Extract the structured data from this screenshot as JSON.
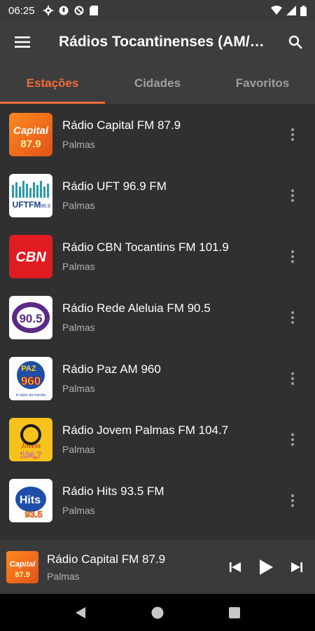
{
  "status_bar": {
    "time": "06:25"
  },
  "app_bar": {
    "title": "Rádios Tocantinenses (AM/FM)"
  },
  "tabs": [
    {
      "label": "Estações",
      "active": true
    },
    {
      "label": "Cidades",
      "active": false
    },
    {
      "label": "Favoritos",
      "active": false
    }
  ],
  "stations": [
    {
      "name": "Rádio Capital FM 87.9",
      "city": "Palmas",
      "logo_text": "Capital",
      "logo_sub": "87.9"
    },
    {
      "name": "Rádio UFT 96.9 FM",
      "city": "Palmas",
      "logo_text": "UFTFM",
      "logo_sub": "96.9"
    },
    {
      "name": "Rádio CBN Tocantins FM 101.9",
      "city": "Palmas",
      "logo_text": "CBN"
    },
    {
      "name": "Rádio Rede Aleluia FM 90.5",
      "city": "Palmas",
      "logo_text": "90.5"
    },
    {
      "name": "Rádio Paz AM 960",
      "city": "Palmas",
      "logo_text": "PAZ",
      "logo_sub": "960",
      "logo_caption": "A rádio da família"
    },
    {
      "name": "Rádio Jovem Palmas FM 104.7",
      "city": "Palmas",
      "logo_text": "Jovem",
      "logo_sub": "104,7"
    },
    {
      "name": "Rádio Hits 93.5 FM",
      "city": "Palmas",
      "logo_text": "Hits",
      "logo_sub": "93.5"
    }
  ],
  "player": {
    "name": "Rádio Capital FM 87.9",
    "city": "Palmas",
    "logo_text": "Capital",
    "logo_sub": "87.9"
  },
  "colors": {
    "accent": "#ef6c3a",
    "background": "#303030",
    "bar": "#3d3d3d"
  }
}
